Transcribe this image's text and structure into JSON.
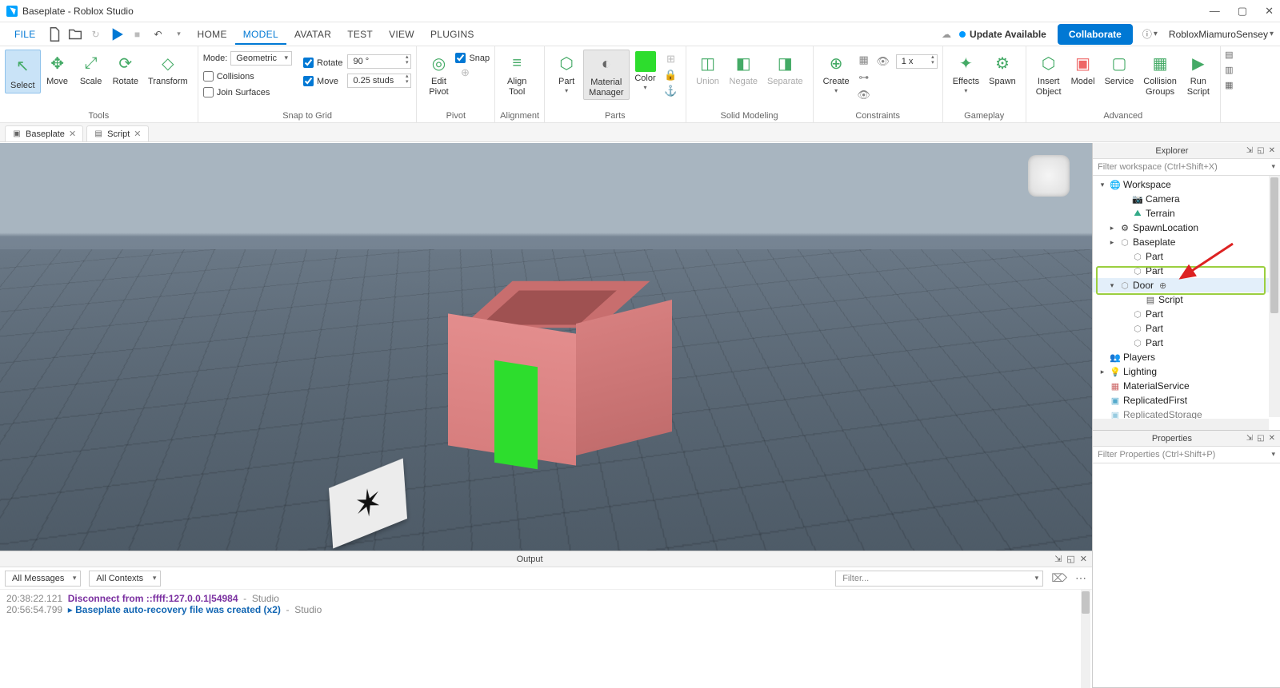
{
  "window": {
    "title": "Baseplate - Roblox Studio"
  },
  "menus": {
    "file": "FILE",
    "tabs": [
      "HOME",
      "MODEL",
      "AVATAR",
      "TEST",
      "VIEW",
      "PLUGINS"
    ],
    "active": "MODEL",
    "update": "Update Available",
    "collaborate": "Collaborate",
    "username": "RobloxMiamuroSensey"
  },
  "ribbon": {
    "tools": {
      "label": "Tools",
      "select": "Select",
      "move": "Move",
      "scale": "Scale",
      "rotate": "Rotate",
      "transform": "Transform"
    },
    "snap": {
      "label": "Snap to Grid",
      "mode_label": "Mode:",
      "mode_value": "Geometric",
      "collisions": "Collisions",
      "join": "Join Surfaces",
      "rotate": "Rotate",
      "rotate_val": "90 °",
      "move": "Move",
      "move_val": "0.25 studs"
    },
    "pivot": {
      "label": "Pivot",
      "snap": "Snap",
      "edit": "Edit\nPivot"
    },
    "align": {
      "label": "Alignment",
      "btn": "Align\nTool"
    },
    "parts": {
      "label": "Parts",
      "part": "Part",
      "mm": "Material\nManager",
      "color": "Color",
      "color_hex": "#2ddd2d"
    },
    "solid": {
      "label": "Solid Modeling",
      "union": "Union",
      "negate": "Negate",
      "separate": "Separate"
    },
    "create": {
      "label": "Constraints",
      "btn": "Create",
      "scale": "1 x"
    },
    "gameplay": {
      "label": "Gameplay",
      "effects": "Effects",
      "spawn": "Spawn"
    },
    "advanced": {
      "label": "Advanced",
      "insert": "Insert\nObject",
      "model": "Model",
      "service": "Service",
      "collision": "Collision\nGroups",
      "run": "Run\nScript"
    }
  },
  "doctabs": [
    {
      "label": "Baseplate",
      "icon": "place"
    },
    {
      "label": "Script",
      "icon": "script"
    }
  ],
  "explorer": {
    "title": "Explorer",
    "filter_placeholder": "Filter workspace (Ctrl+Shift+X)",
    "nodes": {
      "workspace": "Workspace",
      "camera": "Camera",
      "terrain": "Terrain",
      "spawnloc": "SpawnLocation",
      "baseplate": "Baseplate",
      "part1": "Part",
      "part2": "Part",
      "door": "Door",
      "script": "Script",
      "part3": "Part",
      "part4": "Part",
      "part5": "Part",
      "players": "Players",
      "lighting": "Lighting",
      "matsvc": "MaterialService",
      "repfirst": "ReplicatedFirst",
      "repstor": "ReplicatedStorage"
    }
  },
  "properties": {
    "title": "Properties",
    "filter_placeholder": "Filter Properties (Ctrl+Shift+P)"
  },
  "output": {
    "title": "Output",
    "all_messages": "All Messages",
    "all_contexts": "All Contexts",
    "filter_placeholder": "Filter...",
    "lines": {
      "l1_ts": "20:38:22.121",
      "l1_msg": "Disconnect from ::ffff:127.0.0.1|54984",
      "l1_src": "  -  Studio",
      "l2_ts": "20:56:54.799",
      "l2_msg": "Baseplate auto-recovery file was created (x2)",
      "l2_src": "  -  Studio"
    }
  }
}
